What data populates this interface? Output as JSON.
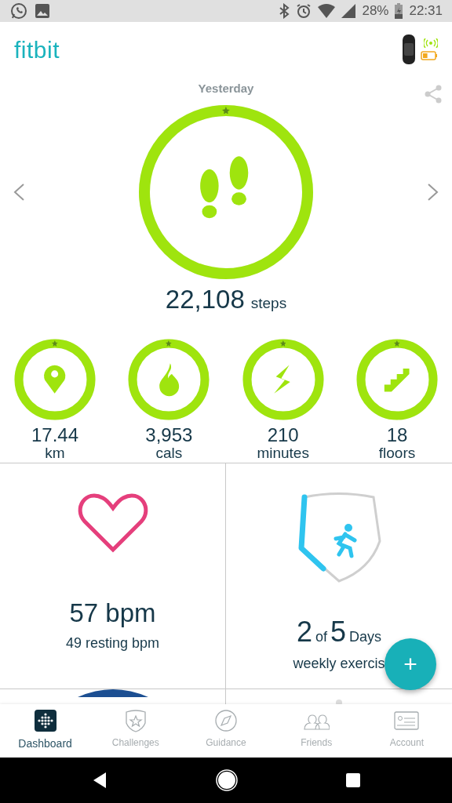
{
  "status_bar": {
    "battery": "28%",
    "time": "22:31"
  },
  "header": {
    "logo": "fitbit"
  },
  "summary": {
    "date": "Yesterday",
    "steps": {
      "value": "22,108",
      "unit": "steps",
      "level": 1
    }
  },
  "stats": [
    {
      "kind": "distance",
      "value": "17.44",
      "unit": "km",
      "level": 1
    },
    {
      "kind": "calories",
      "value": "3,953",
      "unit": "cals",
      "level": 1
    },
    {
      "kind": "active",
      "value": "210",
      "unit": "minutes",
      "level": 1
    },
    {
      "kind": "floors",
      "value": "18",
      "unit": "floors",
      "level": 1
    }
  ],
  "tiles": [
    {
      "kind": "heart",
      "value": "57 bpm",
      "caption": "49 resting bpm"
    },
    {
      "kind": "exercise",
      "count": "2",
      "of": "of",
      "total": "5",
      "unit": "Days",
      "caption": "weekly exercis"
    }
  ],
  "fab": {
    "label": "+"
  },
  "nav": [
    {
      "kind": "dashboard",
      "label": "Dashboard",
      "selected": true
    },
    {
      "kind": "challenges",
      "label": "Challenges",
      "selected": false
    },
    {
      "kind": "guidance",
      "label": "Guidance",
      "selected": false
    },
    {
      "kind": "friends",
      "label": "Friends",
      "selected": false
    },
    {
      "kind": "account",
      "label": "Account",
      "selected": false
    }
  ]
}
